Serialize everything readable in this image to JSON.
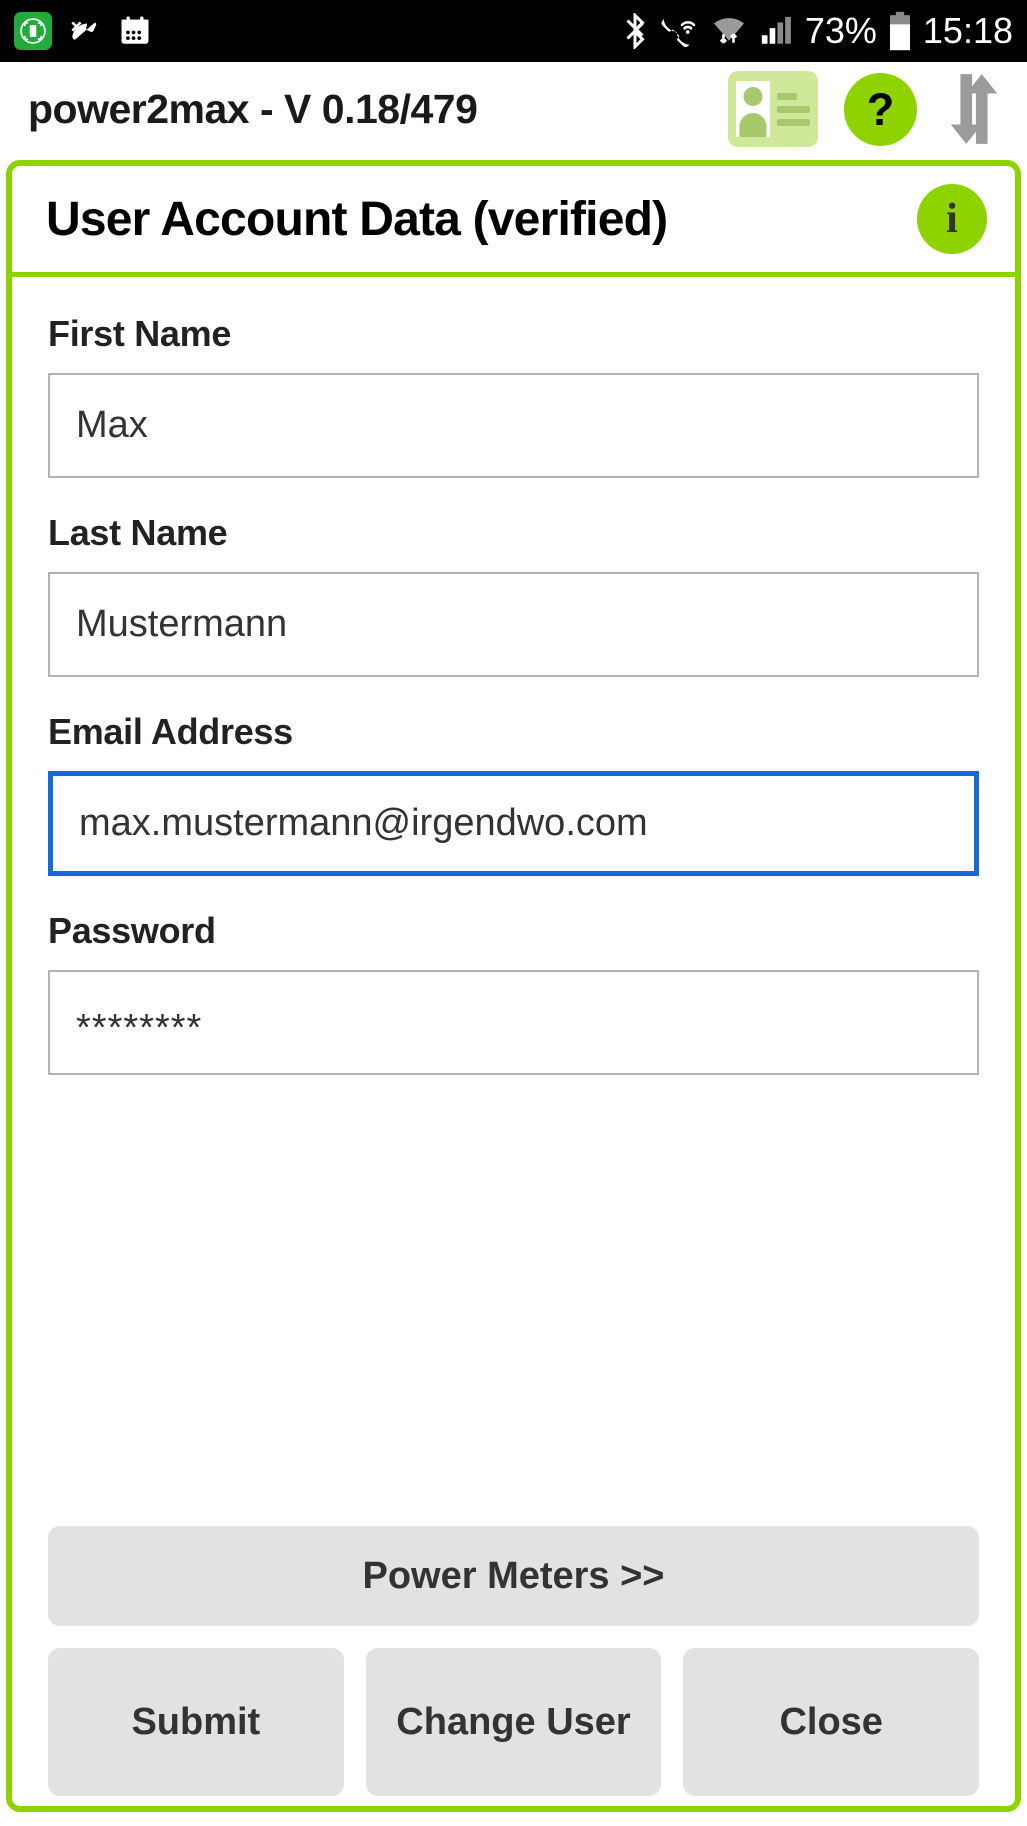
{
  "statusbar": {
    "left_icons": [
      "app-badge-icon",
      "missed-call-icon",
      "calendar-icon"
    ],
    "right_icons": [
      "bluetooth-icon",
      "wifi-calling-icon",
      "wifi-icon",
      "cellular-signal-icon"
    ],
    "battery_percent": "73%",
    "time": "15:18",
    "background": "#000000",
    "foreground": "#ffffff"
  },
  "toolbar": {
    "title": "power2max - V 0.18/479",
    "id_card_icon": "id-card-icon",
    "help_label": "?",
    "sync_icon": "sync-arrows-icon",
    "accent": "#8ed200"
  },
  "card": {
    "title": "User Account Data (verified)",
    "info_label": "i",
    "border_color": "#8ed200"
  },
  "fields": [
    {
      "label": "First Name",
      "value": "Max",
      "focused": false
    },
    {
      "label": "Last Name",
      "value": "Mustermann",
      "focused": false
    },
    {
      "label": "Email Address",
      "value": "max.mustermann@irgendwo.com",
      "focused": true
    },
    {
      "label": "Password",
      "value": "********",
      "focused": false
    }
  ],
  "buttons": {
    "power_meters": "Power Meters >>",
    "submit": "Submit",
    "change_user": "Change User",
    "close": "Close",
    "background": "#e2e2e2"
  }
}
